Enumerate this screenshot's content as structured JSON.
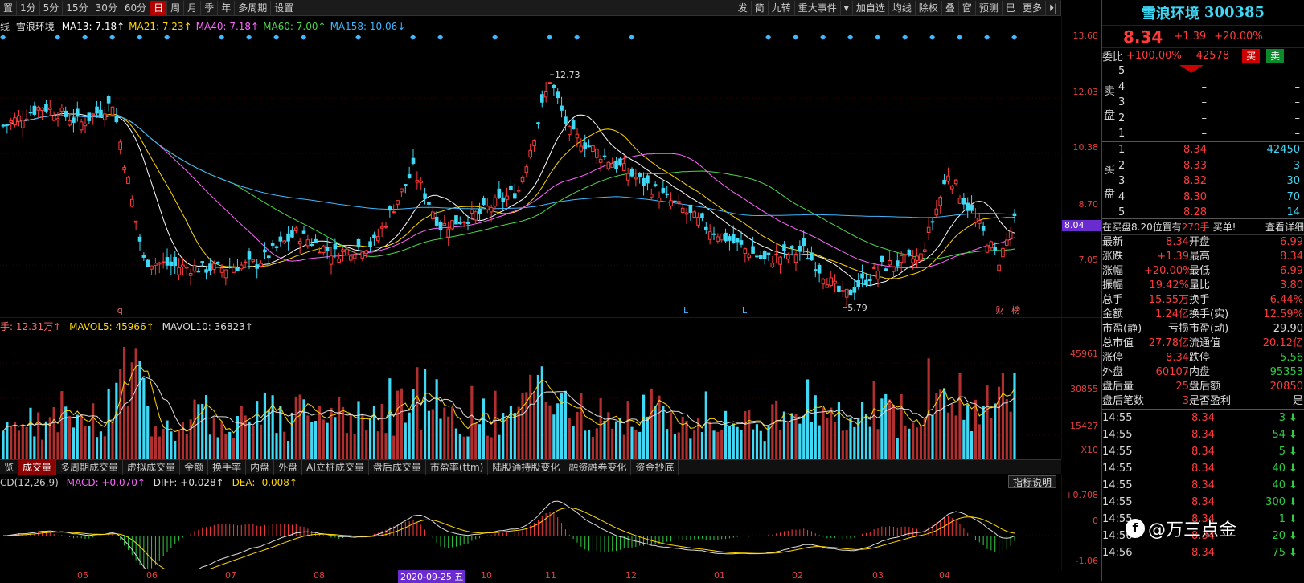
{
  "toolbar": {
    "left": [
      "置",
      "1分",
      "5分",
      "15分",
      "30分",
      "60分",
      "日",
      "周",
      "月",
      "季",
      "年",
      "多周期",
      "设置"
    ],
    "active": "日",
    "right": [
      "发",
      "简",
      "九转",
      "重大事件",
      "▾",
      "加自选",
      "均线",
      "除权",
      "叠",
      "窗",
      "预测",
      "巳",
      "更多",
      "⏵|"
    ]
  },
  "legend": {
    "prefix": "线",
    "name": "雪浪环境",
    "ma": [
      {
        "label": "MA13: 7.18↑",
        "color": "#ffffff"
      },
      {
        "label": "MA21: 7.23↑",
        "color": "#ffd700"
      },
      {
        "label": "MA40: 7.18↑",
        "color": "#ff66ff"
      },
      {
        "label": "MA60: 7.00↑",
        "color": "#4bd84b"
      },
      {
        "label": "MA158: 10.06↓",
        "color": "#3fb8ff"
      }
    ]
  },
  "price_axis": [
    "13.68",
    "12.03",
    "10.38",
    "8.70",
    "7.05"
  ],
  "price_current": "8.04",
  "annotations": {
    "high": "12.73",
    "low": "5.79",
    "markers": [
      "L",
      "L",
      "财",
      "榜"
    ],
    "q": "q"
  },
  "volume_legend": {
    "prefix": "手: 12.31万↑",
    "mavol5": "MAVOL5: 45966↑",
    "mavol10": "MAVOL10: 36823↑"
  },
  "volume_axis": [
    "45961",
    "30855",
    "15427",
    "X10"
  ],
  "volume_tabs": [
    "览",
    "成交量",
    "多周期成交量",
    "虚拟成交量",
    "金额",
    "换手率",
    "内盘",
    "外盘",
    "AI立桩成交量",
    "盘后成交量",
    "市盈率(ttm)",
    "陆股通持股变化",
    "融资融券变化",
    "资金抄底"
  ],
  "volume_tab_active": "成交量",
  "macd_legend": {
    "label": "CD(12,26,9)",
    "macd": "MACD: +0.070↑",
    "diff": "DIFF: +0.028↑",
    "dea": "DEA: -0.008↑",
    "explain": "指标说明"
  },
  "macd_axis": [
    "+0.708",
    "0",
    "-1.06"
  ],
  "date_axis": [
    "05",
    "06",
    "07",
    "08",
    "2020-09-25 五",
    "10",
    "11",
    "12",
    "01",
    "02",
    "03",
    "04"
  ],
  "stock": {
    "name": "雪浪环境",
    "code": "300385",
    "price": "8.34",
    "change": "+1.39",
    "pct": "+20.00%"
  },
  "weibi": {
    "label": "委比",
    "pct": "+100.00%",
    "val": "42578",
    "sell": "买",
    "buy": "卖"
  },
  "sell_orders": [
    {
      "n": "5",
      "p": "",
      "v": ""
    },
    {
      "n": "4",
      "p": "–",
      "v": "–"
    },
    {
      "n": "3",
      "p": "–",
      "v": "–"
    },
    {
      "n": "2",
      "p": "–",
      "v": "–"
    },
    {
      "n": "1",
      "p": "–",
      "v": "–"
    }
  ],
  "buy_orders": [
    {
      "n": "1",
      "p": "8.34",
      "v": "42450"
    },
    {
      "n": "2",
      "p": "8.33",
      "v": "3"
    },
    {
      "n": "3",
      "p": "8.32",
      "v": "30"
    },
    {
      "n": "4",
      "p": "8.30",
      "v": "70"
    },
    {
      "n": "5",
      "p": "8.28",
      "v": "14"
    }
  ],
  "sell_label": [
    "卖",
    "盘"
  ],
  "buy_label": [
    "买",
    "盘"
  ],
  "buy_note": {
    "text": "在买盘8.20位置有",
    "vol": "270手",
    "tail": "买单!",
    "link": "查看详细"
  },
  "stats": [
    {
      "k1": "最新",
      "v1": "8.34",
      "c1": "red",
      "k2": "开盘",
      "v2": "6.99",
      "c2": "red"
    },
    {
      "k1": "涨跌",
      "v1": "+1.39",
      "c1": "red",
      "k2": "最高",
      "v2": "8.34",
      "c2": "red"
    },
    {
      "k1": "涨幅",
      "v1": "+20.00%",
      "c1": "red",
      "k2": "最低",
      "v2": "6.99",
      "c2": "red"
    },
    {
      "k1": "振幅",
      "v1": "19.42%",
      "c1": "red",
      "k2": "量比",
      "v2": "3.80",
      "c2": "red"
    },
    {
      "k1": "总手",
      "v1": "15.55万",
      "c1": "red",
      "k2": "换手",
      "v2": "6.44%",
      "c2": "red"
    },
    {
      "k1": "金额",
      "v1": "1.24亿",
      "c1": "red",
      "k2": "换手(实)",
      "v2": "12.59%",
      "c2": "red"
    },
    {
      "k1": "市盈(静)",
      "v1": "亏损",
      "c1": "white",
      "k2": "市盈(动)",
      "v2": "29.90",
      "c2": "white"
    },
    {
      "k1": "总市值",
      "v1": "27.78亿",
      "c1": "red",
      "k2": "流通值",
      "v2": "20.12亿",
      "c2": "red"
    },
    {
      "k1": "涨停",
      "v1": "8.34",
      "c1": "red",
      "k2": "跌停",
      "v2": "5.56",
      "c2": "green"
    },
    {
      "k1": "外盘",
      "v1": "60107",
      "c1": "red",
      "k2": "内盘",
      "v2": "95353",
      "c2": "green"
    },
    {
      "k1": "盘后量",
      "v1": "25",
      "c1": "red",
      "k2": "盘后额",
      "v2": "20850",
      "c2": "red"
    },
    {
      "k1": "盘后笔数",
      "v1": "3",
      "c1": "red",
      "k2": "是否盈利",
      "v2": "是",
      "c2": "white"
    }
  ],
  "ticks": [
    {
      "t": "14:55",
      "p": "8.34",
      "v": "3"
    },
    {
      "t": "14:55",
      "p": "8.34",
      "v": "54"
    },
    {
      "t": "14:55",
      "p": "8.34",
      "v": "5"
    },
    {
      "t": "14:55",
      "p": "8.34",
      "v": "40"
    },
    {
      "t": "14:55",
      "p": "8.34",
      "v": "40"
    },
    {
      "t": "14:55",
      "p": "8.34",
      "v": "300"
    },
    {
      "t": "14:55",
      "p": "8.34",
      "v": "1"
    },
    {
      "t": "14:56",
      "p": "8.34",
      "v": "20"
    },
    {
      "t": "14:56",
      "p": "8.34",
      "v": "75"
    }
  ],
  "watermark": "@万三点金",
  "chart_data": {
    "type": "candlestick",
    "price_range": [
      5.5,
      14.0
    ],
    "ohlc_summary": {
      "high": 12.73,
      "low": 5.79,
      "last_close": 8.34
    },
    "moving_averages": [
      "MA13",
      "MA21",
      "MA40",
      "MA60",
      "MA158"
    ]
  }
}
